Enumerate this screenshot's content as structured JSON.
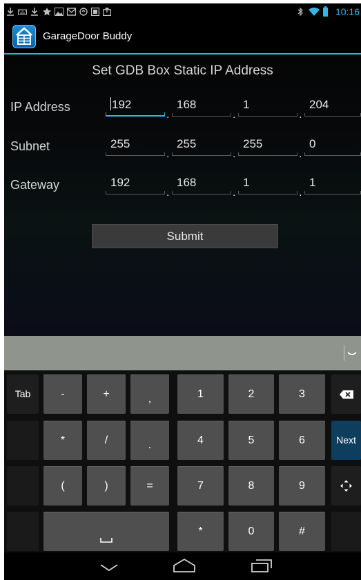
{
  "status_bar": {
    "time": "10:16",
    "icons": [
      "download-icon",
      "keyboard-icon",
      "download-icon",
      "star-icon",
      "image-icon",
      "gmail-icon",
      "sync-icon",
      "screenshot-icon",
      "upload-icon",
      "bluetooth-icon",
      "wifi-icon",
      "battery-icon"
    ]
  },
  "action_bar": {
    "app_title": "GarageDoor Buddy",
    "app_icon": "garage-door-icon"
  },
  "form": {
    "title": "Set GDB Box Static IP Address",
    "separator": ".",
    "rows": [
      {
        "label": "IP Address",
        "octets": [
          "192",
          "168",
          "1",
          "204"
        ]
      },
      {
        "label": "Subnet",
        "octets": [
          "255",
          "255",
          "255",
          "0"
        ]
      },
      {
        "label": "Gateway",
        "octets": [
          "192",
          "168",
          "1",
          "1"
        ]
      }
    ],
    "submit_label": "Submit"
  },
  "keyboard": {
    "tab_label": "Tab",
    "next_label": "Next",
    "rows": [
      [
        "-",
        "+",
        ",",
        "1",
        "2",
        "3"
      ],
      [
        "*",
        "/",
        ".",
        "4",
        "5",
        "6"
      ],
      [
        "(",
        ")",
        "=",
        "7",
        "8",
        "9"
      ],
      [
        "space",
        "*",
        "0",
        "#"
      ]
    ],
    "backspace_icon": "backspace-icon",
    "cursor_move_icon": "cursor-move-icon",
    "hide_icon": "chevron-down-icon"
  },
  "navigation": {
    "back_icon": "back-icon",
    "home_icon": "home-icon",
    "recents_icon": "recents-icon"
  },
  "colors": {
    "accent": "#33b5e5",
    "key": "#4f4f4f",
    "next_key": "#0e3d5e"
  }
}
